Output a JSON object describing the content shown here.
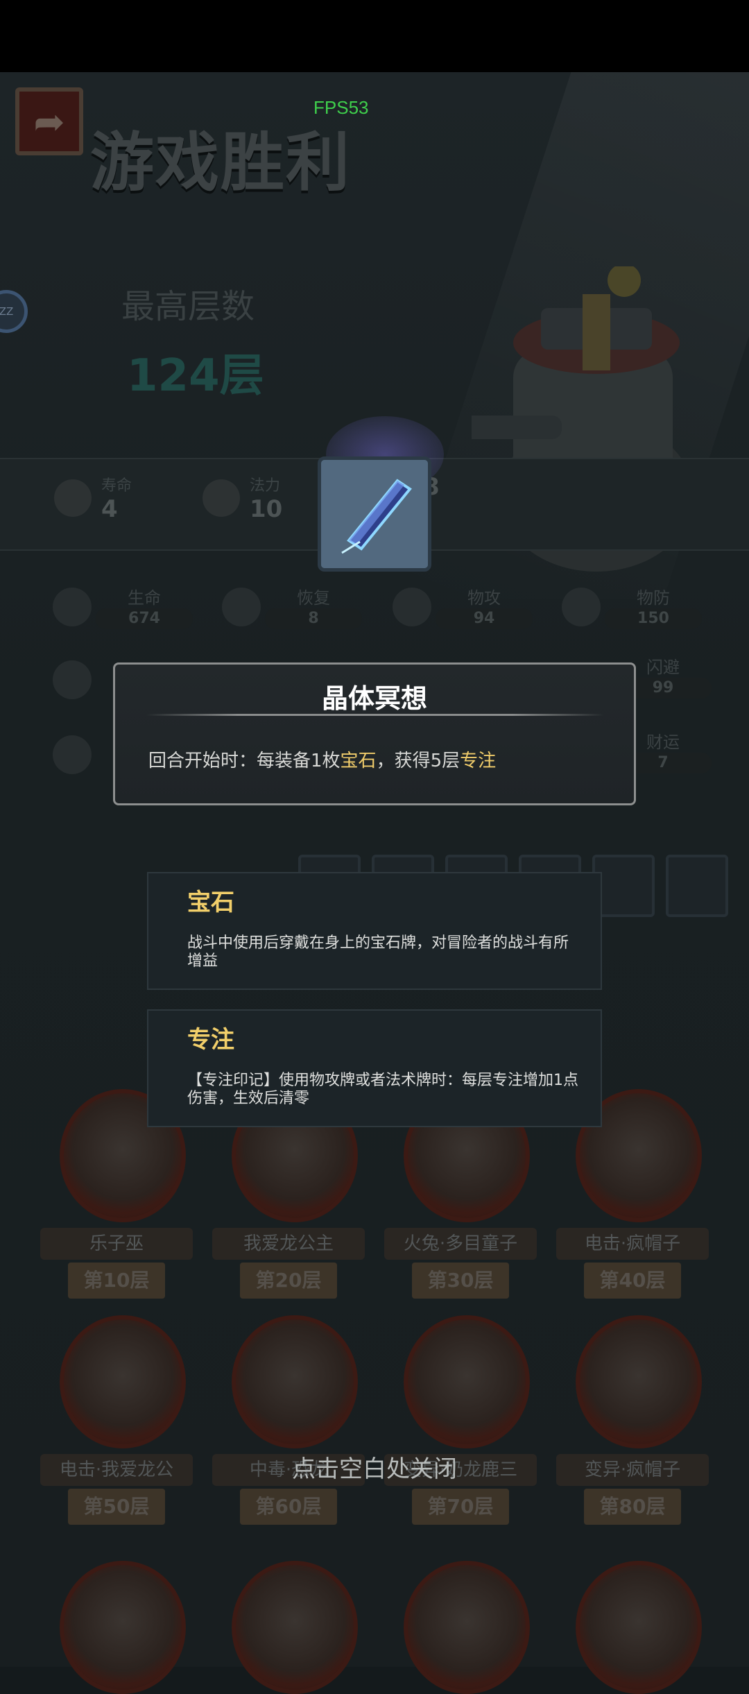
{
  "hud": {
    "fps": "FPS53",
    "side_badge": "ZZ"
  },
  "result": {
    "title": "游戏胜利",
    "best_floor_label": "最高层数",
    "best_floor_value": "124层"
  },
  "top_stats": [
    {
      "label": "寿命",
      "value": "4",
      "icon": "heart-face-icon"
    },
    {
      "label": "法力",
      "value": "10",
      "icon": "flame-icon"
    },
    {
      "label": "",
      "value": "8",
      "icon": "unknown-icon"
    }
  ],
  "attributes_row1": [
    {
      "label": "生命",
      "value": "674",
      "icon": "heart-icon"
    },
    {
      "label": "恢复",
      "value": "8",
      "icon": "heart-plus-icon"
    },
    {
      "label": "物攻",
      "value": "94",
      "icon": "sword-icon"
    },
    {
      "label": "物防",
      "value": "150",
      "icon": "shield-icon"
    }
  ],
  "attributes_row2": [
    {
      "label": "闪避",
      "value": "99",
      "icon": "dodge-icon"
    }
  ],
  "attributes_row3": [
    {
      "label": "财运",
      "value": "7",
      "icon": "coin-icon"
    }
  ],
  "popup": {
    "title": "晶体冥想",
    "desc_prefix": "回合开始时：每装备1枚",
    "desc_hl1": "宝石",
    "desc_mid": "，获得5层",
    "desc_hl2": "专注"
  },
  "tips": [
    {
      "title": "宝石",
      "desc": "战斗中使用后穿戴在身上的宝石牌，对冒险者的战斗有所增益"
    },
    {
      "title": "专注",
      "desc": "【专注印记】使用物攻牌或者法术牌时：每层专注增加1点伤害，生效后清零"
    }
  ],
  "bosses": [
    {
      "name": "乐子巫",
      "floor": "第10层"
    },
    {
      "name": "我爱龙公主",
      "floor": "第20层"
    },
    {
      "name": "火兔·多目童子",
      "floor": "第30层"
    },
    {
      "name": "电击·疯帽子",
      "floor": "第40层"
    },
    {
      "name": "电击·我爱龙公",
      "floor": "第50层"
    },
    {
      "name": "中毒·恐龙",
      "floor": "第60层"
    },
    {
      "name": "变异·奶龙鹿三",
      "floor": "第70层"
    },
    {
      "name": "变异·疯帽子",
      "floor": "第80层"
    }
  ],
  "close_hint": "点击空白处关闭",
  "colors": {
    "highlight": "#f1cd6b",
    "fps": "#3fcf4c",
    "popup_border": "#8d8f8f"
  }
}
